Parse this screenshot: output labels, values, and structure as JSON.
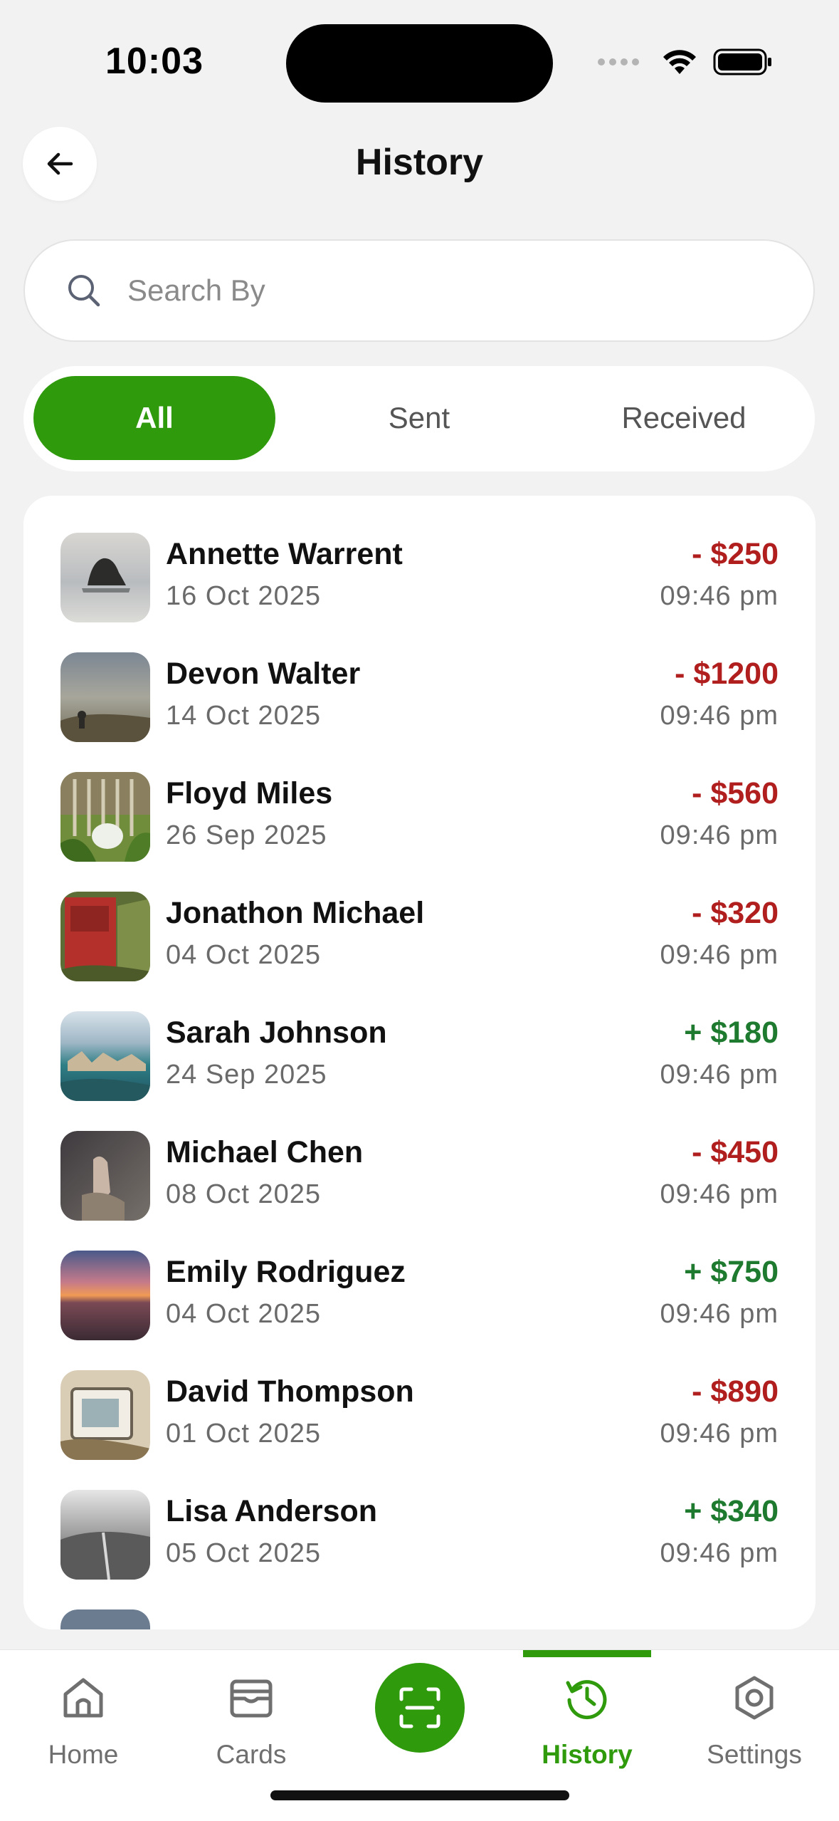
{
  "status_bar": {
    "time": "10:03"
  },
  "header": {
    "title": "History"
  },
  "search": {
    "placeholder": "Search By"
  },
  "filters": {
    "items": [
      "All",
      "Sent",
      "Received"
    ],
    "selected": "All"
  },
  "colors": {
    "accent": "#2e9a0c",
    "debit": "#b01e1e",
    "credit": "#1d7a2e",
    "background": "#f2f2f2"
  },
  "transactions": [
    {
      "name": "Annette Warrent",
      "date": "16 Oct 2025",
      "amount": "- $250",
      "time": "09:46 pm",
      "direction": "sent"
    },
    {
      "name": "Devon Walter",
      "date": "14 Oct 2025",
      "amount": "- $1200",
      "time": "09:46 pm",
      "direction": "sent"
    },
    {
      "name": "Floyd Miles",
      "date": "26 Sep 2025",
      "amount": "- $560",
      "time": "09:46 pm",
      "direction": "sent"
    },
    {
      "name": "Jonathon Michael",
      "date": "04 Oct 2025",
      "amount": "- $320",
      "time": "09:46 pm",
      "direction": "sent"
    },
    {
      "name": "Sarah Johnson",
      "date": "24 Sep 2025",
      "amount": "+ $180",
      "time": "09:46 pm",
      "direction": "received"
    },
    {
      "name": "Michael Chen",
      "date": "08 Oct 2025",
      "amount": "- $450",
      "time": "09:46 pm",
      "direction": "sent"
    },
    {
      "name": "Emily Rodriguez",
      "date": "04 Oct 2025",
      "amount": "+ $750",
      "time": "09:46 pm",
      "direction": "received"
    },
    {
      "name": "David Thompson",
      "date": "01 Oct 2025",
      "amount": "- $890",
      "time": "09:46 pm",
      "direction": "sent"
    },
    {
      "name": "Lisa Anderson",
      "date": "05 Oct 2025",
      "amount": "+ $340",
      "time": "09:46 pm",
      "direction": "received"
    }
  ],
  "tabbar": {
    "items": [
      {
        "label": "Home",
        "icon": "home-icon"
      },
      {
        "label": "Cards",
        "icon": "card-icon"
      },
      {
        "label": "",
        "icon": "scan-icon"
      },
      {
        "label": "History",
        "icon": "history-icon"
      },
      {
        "label": "Settings",
        "icon": "settings-icon"
      }
    ],
    "active": "History"
  }
}
